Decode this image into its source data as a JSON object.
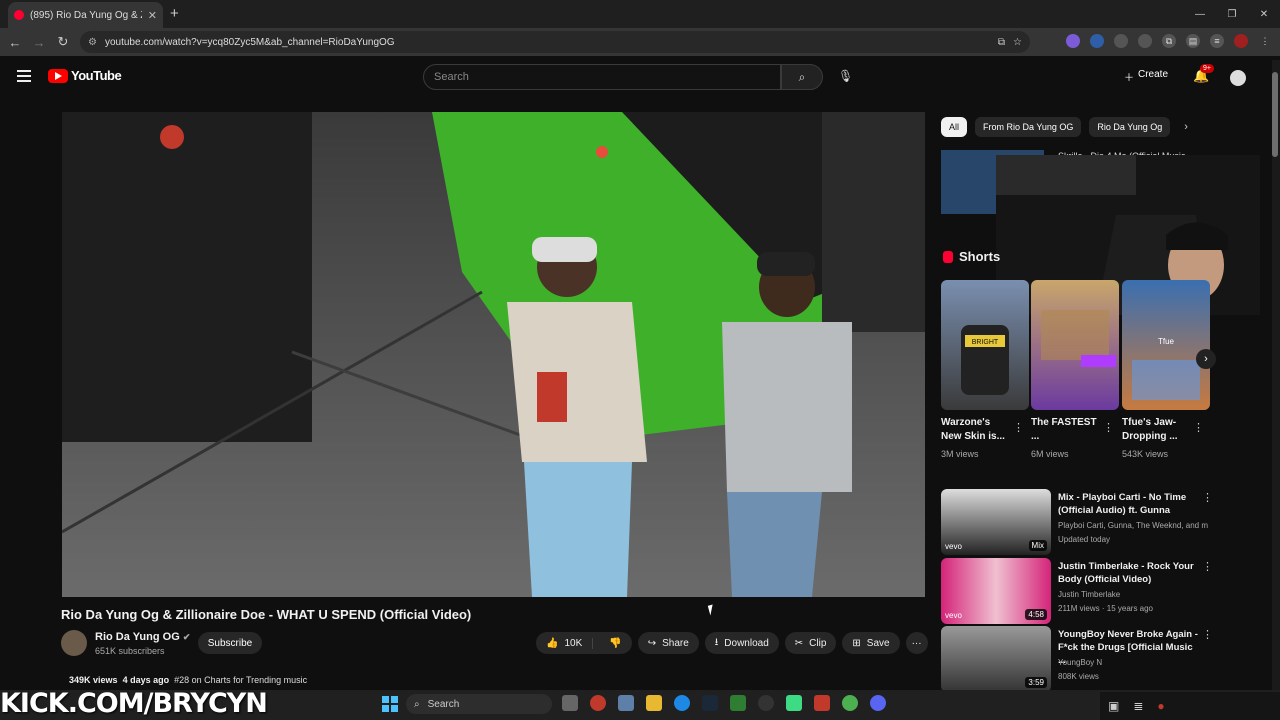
{
  "browser": {
    "tab_title": "(895) Rio Da Yung Og & Zilli",
    "tab_close": "✕",
    "new_tab": "+",
    "url": "youtube.com/watch?v=ycq80Zyc5M&ab_channel=RioDaYungOG",
    "window_controls": [
      "—",
      "❐",
      "✕"
    ]
  },
  "youtube": {
    "logo_text": "YouTube",
    "search_placeholder": "Search",
    "create_label": "Create",
    "notif_count": "9+"
  },
  "video": {
    "title": "Rio Da Yung Og & Zillionaire Doe - WHAT U SPEND (Official Video)",
    "channel": "Rio Da Yung OG",
    "subscribers": "651K subscribers",
    "subscribe_label": "Subscribe",
    "likes": "10K",
    "share_label": "Share",
    "download_label": "Download",
    "clip_label": "Clip",
    "save_label": "Save",
    "more_label": "···",
    "views": "349K views",
    "age": "4 days ago",
    "chart_text": "#28 on Charts for Trending music"
  },
  "sidebar": {
    "chips": [
      "All",
      "From Rio Da Yung OG",
      "Rio Da Yung Og"
    ],
    "top_item_title": "Skrilla - Die 4 Me (Official Music",
    "shorts_label": "Shorts",
    "shorts": [
      {
        "title": "Warzone's New Skin is...",
        "views": "3M views",
        "thumb_text": "BRIGHT"
      },
      {
        "title": "The FASTEST ...",
        "views": "6M views",
        "thumb_text": ""
      },
      {
        "title": "Tfue's Jaw-Dropping ...",
        "views": "543K views",
        "thumb_text": "Tfue"
      }
    ],
    "recs": [
      {
        "title": "Mix - Playboi Carti - No Time (Official Audio) ft. Gunna",
        "line1": "Playboi Carti, Gunna, The Weeknd, and m...",
        "line2": "Updated today",
        "badge": "Mix",
        "thumb_text": "vevo"
      },
      {
        "title": "Justin Timberlake - Rock Your Body (Official Video)",
        "line1": "Justin Timberlake",
        "line2": "211M views · 15 years ago",
        "badge": "4:58",
        "thumb_text": "vevo"
      },
      {
        "title": "YoungBoy Never Broke Again - F*ck the Drugs [Official Music ...",
        "line1": "YoungBoy N",
        "line2": "808K views",
        "badge": "3:59",
        "thumb_text": ""
      }
    ]
  },
  "overlay": {
    "kick_text": "KICK.COM/BRYCYN"
  },
  "taskbar": {
    "search_label": "Search"
  },
  "colors": {
    "yt_red": "#ff0000",
    "bg": "#0f0f0f",
    "pill": "#272727"
  }
}
